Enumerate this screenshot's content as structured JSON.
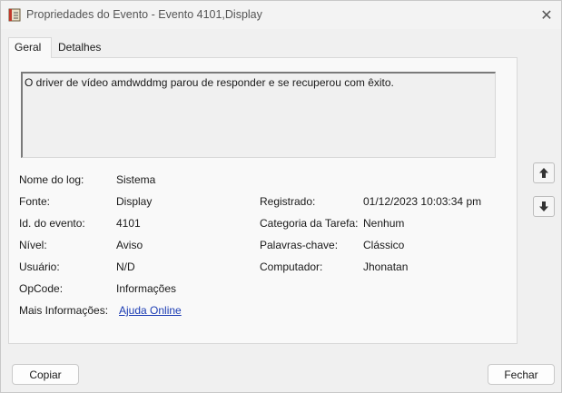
{
  "window": {
    "title": "Propriedades do Evento - Evento 4101,Display",
    "close_glyph": "✕"
  },
  "tabs": [
    {
      "label": "Geral",
      "active": true
    },
    {
      "label": "Detalhes",
      "active": false
    }
  ],
  "description": "O driver de vídeo amdwddmg parou de responder e se recuperou com êxito.",
  "fields_left": [
    {
      "label": "Nome do log:",
      "value": "Sistema"
    },
    {
      "label": "Fonte:",
      "value": "Display"
    },
    {
      "label": "Id. do evento:",
      "value": "4101"
    },
    {
      "label": "Nível:",
      "value": "Aviso"
    },
    {
      "label": "Usuário:",
      "value": "N/D"
    },
    {
      "label": "OpCode:",
      "value": "Informações"
    },
    {
      "label": "Mais Informações:",
      "value": "Ajuda Online"
    }
  ],
  "fields_right": [
    {
      "label": "Registrado:",
      "value": "01/12/2023 10:03:34 pm"
    },
    {
      "label": "Categoria da Tarefa:",
      "value": "Nenhum"
    },
    {
      "label": "Palavras-chave:",
      "value": "Clássico"
    },
    {
      "label": "Computador:",
      "value": "Jhonatan"
    }
  ],
  "nav": {
    "up_icon": "arrow-up-icon",
    "down_icon": "arrow-down-icon"
  },
  "buttons": {
    "copy_label": "Copiar",
    "close_label": "Fechar"
  },
  "colors": {
    "link": "#1a3bb3",
    "background": "#f0f0f0"
  }
}
